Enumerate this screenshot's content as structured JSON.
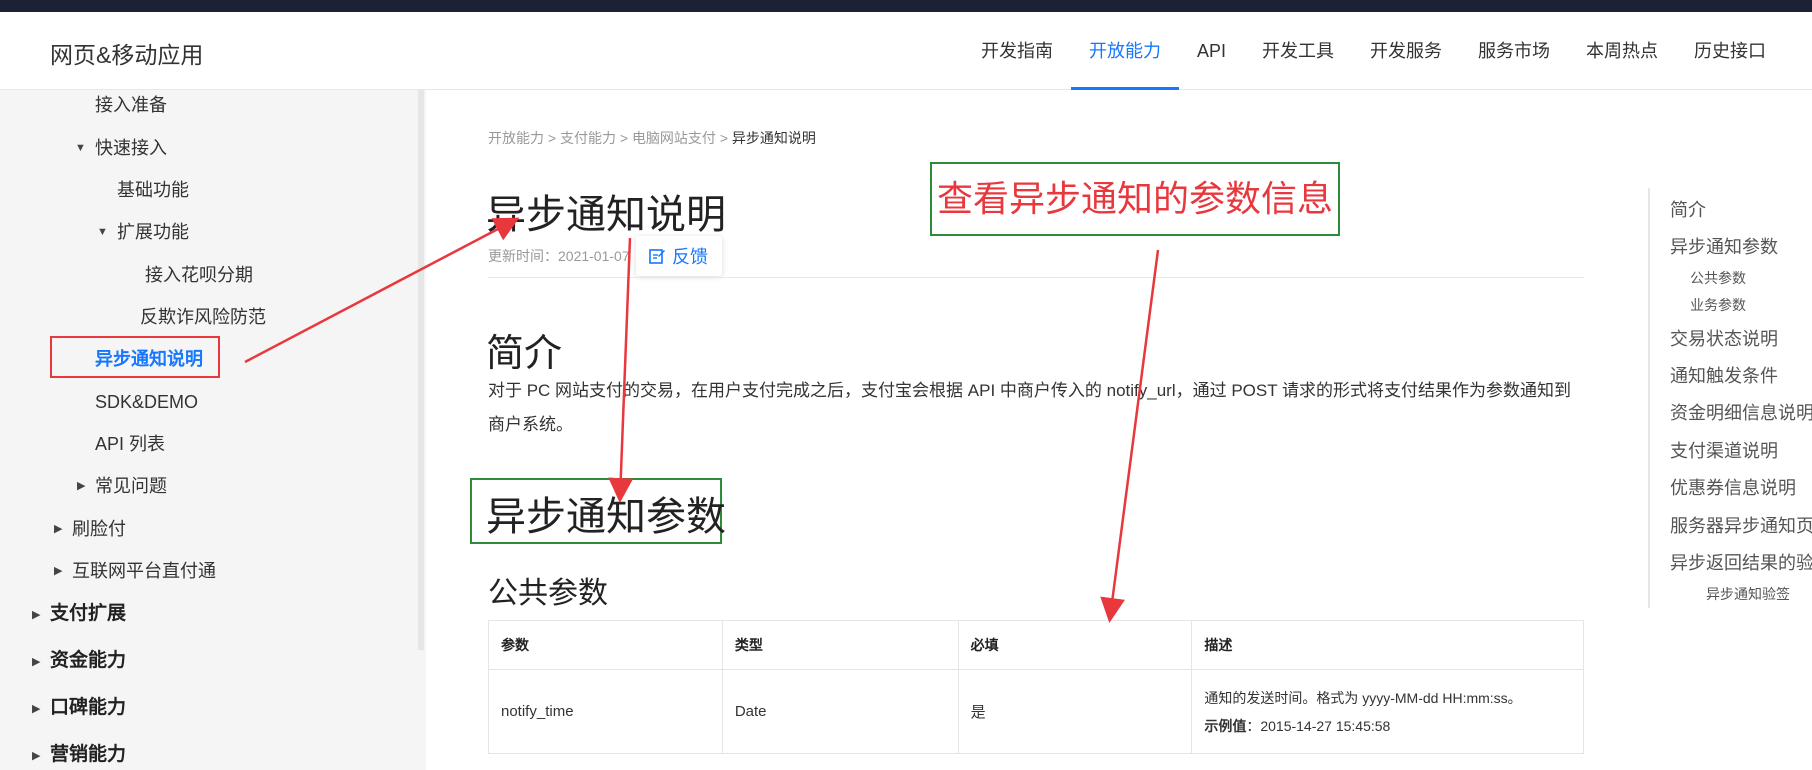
{
  "header": {
    "brand": "网页&移动应用",
    "nav": [
      "开发指南",
      "开放能力",
      "API",
      "开发工具",
      "开发服务",
      "服务市场",
      "本周热点",
      "历史接口"
    ],
    "active_index": 1
  },
  "sidebar": {
    "items": [
      {
        "label": "接入准备"
      },
      {
        "label": "快速接入"
      },
      {
        "label": "基础功能"
      },
      {
        "label": "扩展功能"
      },
      {
        "label": "接入花呗分期"
      },
      {
        "label": "反欺诈风险防范"
      },
      {
        "label": "异步通知说明"
      },
      {
        "label": "SDK&DEMO"
      },
      {
        "label": "API 列表"
      },
      {
        "label": "常见问题"
      },
      {
        "label": "刷脸付"
      },
      {
        "label": "互联网平台直付通"
      },
      {
        "label": "支付扩展"
      },
      {
        "label": "资金能力"
      },
      {
        "label": "口碑能力"
      },
      {
        "label": "营销能力"
      }
    ]
  },
  "breadcrumb": {
    "items": [
      "开放能力",
      "支付能力",
      "电脑网站支付"
    ],
    "separator": ">",
    "current": "异步通知说明"
  },
  "article": {
    "title": "异步通知说明",
    "updated": "更新时间：2021-01-07",
    "feedback_label": "反馈",
    "intro_heading": "简介",
    "intro_text": "对于 PC 网站支付的交易，在用户支付完成之后，支付宝会根据 API 中商户传入的 notify_url，通过 POST 请求的形式将支付结果作为参数通知到商户系统。",
    "params_heading": "异步通知参数",
    "common_heading": "公共参数",
    "table": {
      "headers": [
        "参数",
        "类型",
        "必填",
        "描述"
      ],
      "rows": [
        {
          "param": "notify_time",
          "type": "Date",
          "required": "是",
          "desc": "通知的发送时间。格式为 yyyy-MM-dd HH:mm:ss。",
          "example_label": "示例值",
          "example_value": "：2015-14-27 15:45:58"
        }
      ]
    }
  },
  "annotation": {
    "callout": "查看异步通知的参数信息",
    "colors": {
      "arrow": "#e8383d",
      "box_green": "#2e8b3a",
      "box_red": "#e8383d"
    }
  },
  "toc": {
    "items": [
      "简介",
      "异步通知参数",
      "公共参数",
      "业务参数",
      "交易状态说明",
      "通知触发条件",
      "资金明细信息说明",
      "支付渠道说明",
      "优惠券信息说明",
      "服务器异步通知页",
      "异步返回结果的验",
      "异步通知验签"
    ]
  },
  "theme": {
    "accent": "#1677ff",
    "topbar": "#1c2233"
  }
}
